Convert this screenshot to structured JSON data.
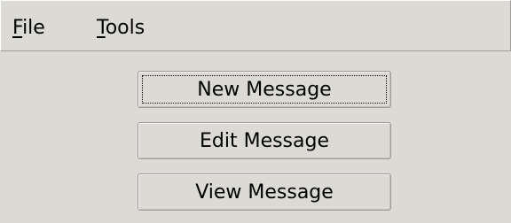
{
  "menubar": {
    "file": {
      "mnemonic": "F",
      "rest": "ile"
    },
    "tools": {
      "mnemonic": "T",
      "rest": "ools"
    }
  },
  "buttons": {
    "new_message": "New Message",
    "edit_message": "Edit Message",
    "view_message": "View Message"
  }
}
